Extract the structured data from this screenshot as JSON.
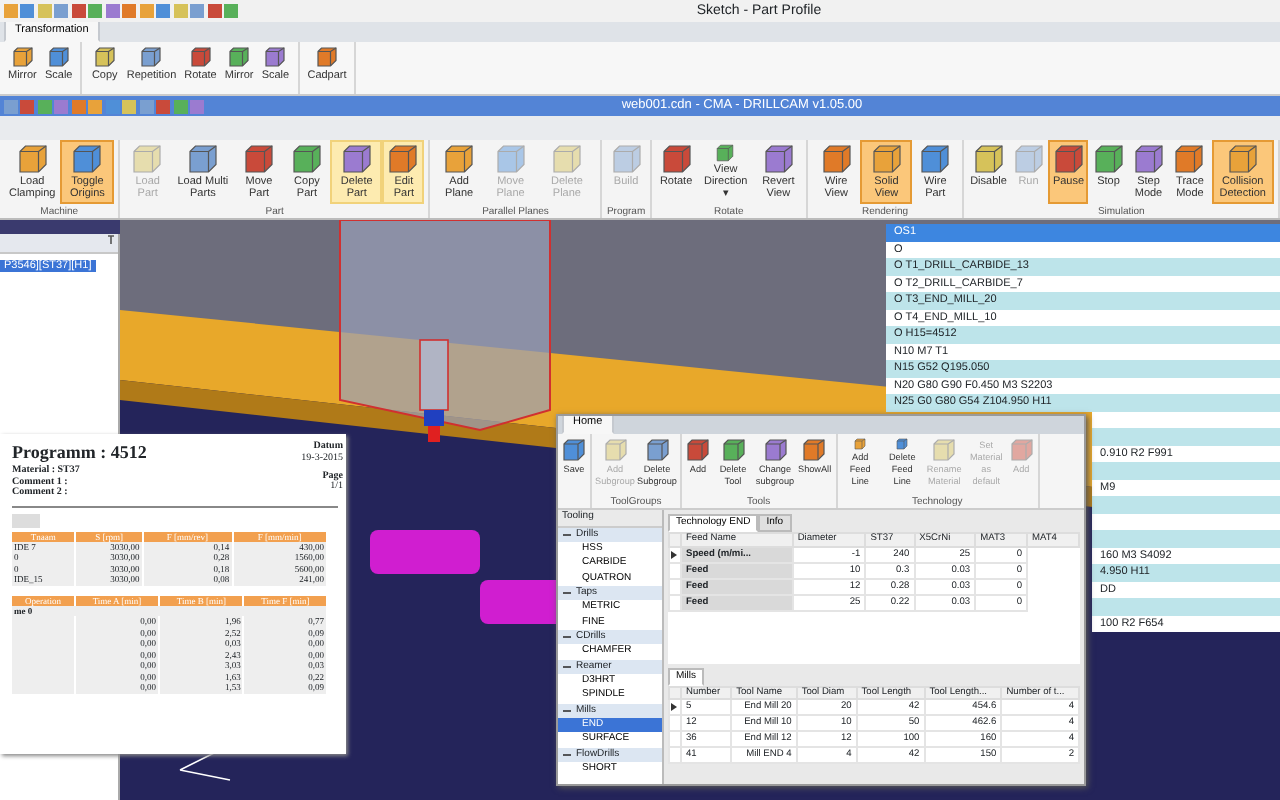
{
  "back_window": {
    "title": "Sketch - Part Profile",
    "tabs": [
      {
        "label": "Transformation",
        "selected": true
      }
    ],
    "ribbon": [
      {
        "buttons": [
          {
            "label": "Mirror",
            "disabled": false
          },
          {
            "label": "Scale",
            "disabled": false
          }
        ]
      },
      {
        "buttons": [
          {
            "label": "Copy",
            "disabled": false
          },
          {
            "label": "Repetition",
            "disabled": false
          },
          {
            "label": "Rotate",
            "disabled": false
          },
          {
            "label": "Mirror",
            "disabled": false
          },
          {
            "label": "Scale",
            "disabled": false
          }
        ]
      },
      {
        "buttons": [
          {
            "label": "Cadpart",
            "disabled": false
          }
        ]
      }
    ]
  },
  "main_window": {
    "title": "web001.cdn - CMA - DRILLCAM v1.05.00",
    "ribbon": [
      {
        "label": "Machine",
        "buttons": [
          {
            "label": "Load Clamping",
            "selected": false,
            "hover": false,
            "disabled": false
          },
          {
            "label": "Toggle Origins",
            "selected": true,
            "hover": false,
            "disabled": false
          }
        ]
      },
      {
        "label": "Part",
        "buttons": [
          {
            "label": "Load Part",
            "selected": false,
            "hover": false,
            "disabled": true
          },
          {
            "label": "Load Multi Parts",
            "selected": false,
            "hover": false,
            "disabled": false
          },
          {
            "label": "Move Part",
            "selected": false,
            "hover": false,
            "disabled": false
          },
          {
            "label": "Copy Part",
            "selected": false,
            "hover": false,
            "disabled": false
          },
          {
            "label": "Delete Part",
            "selected": false,
            "hover": true,
            "disabled": false
          },
          {
            "label": "Edit Part",
            "selected": false,
            "hover": true,
            "disabled": false
          }
        ]
      },
      {
        "label": "Parallel Planes",
        "buttons": [
          {
            "label": "Add Plane",
            "selected": false,
            "hover": false,
            "disabled": false
          },
          {
            "label": "Move Plane",
            "selected": false,
            "hover": false,
            "disabled": true
          },
          {
            "label": "Delete Plane",
            "selected": false,
            "hover": false,
            "disabled": true
          }
        ]
      },
      {
        "label": "Program",
        "buttons": [
          {
            "label": "Build",
            "selected": false,
            "hover": false,
            "disabled": true
          }
        ]
      },
      {
        "label": "Rotate",
        "buttons": [
          {
            "label": "Rotate",
            "selected": false,
            "hover": false,
            "disabled": false
          },
          {
            "label": "View Direction ▾",
            "selected": false,
            "hover": false,
            "disabled": false
          },
          {
            "label": "Revert View",
            "selected": false,
            "hover": false,
            "disabled": false
          }
        ]
      },
      {
        "label": "Rendering",
        "buttons": [
          {
            "label": "Wire View",
            "selected": false,
            "hover": false,
            "disabled": false
          },
          {
            "label": "Solid View",
            "selected": true,
            "hover": false,
            "disabled": false
          },
          {
            "label": "Wire Part",
            "selected": false,
            "hover": false,
            "disabled": false
          }
        ]
      },
      {
        "label": "Simulation",
        "buttons": [
          {
            "label": "Disable",
            "selected": false,
            "hover": false,
            "disabled": false
          },
          {
            "label": "Run",
            "selected": false,
            "hover": false,
            "disabled": true
          },
          {
            "label": "Pause",
            "selected": true,
            "hover": false,
            "disabled": false
          },
          {
            "label": "Stop",
            "selected": false,
            "hover": false,
            "disabled": false
          },
          {
            "label": "Step Mode",
            "selected": false,
            "hover": false,
            "disabled": false
          },
          {
            "label": "Trace Mode",
            "selected": false,
            "hover": false,
            "disabled": false
          },
          {
            "label": "Collision Detection",
            "selected": true,
            "hover": false,
            "disabled": false
          }
        ]
      }
    ]
  },
  "part_panel": {
    "items": [
      {
        "label": "P3546][ST37][H1]",
        "selected": true
      }
    ]
  },
  "nc_program": {
    "rows": [
      {
        "kind": "full",
        "text": "OS1",
        "selected": true
      },
      {
        "kind": "full",
        "text": "O",
        "selected": false
      },
      {
        "kind": "full",
        "text": "O T1_DRILL_CARBIDE_13",
        "selected": false
      },
      {
        "kind": "full",
        "text": "O T2_DRILL_CARBIDE_7",
        "selected": false
      },
      {
        "kind": "full",
        "text": "O T3_END_MILL_20",
        "selected": false
      },
      {
        "kind": "full",
        "text": "O T4_END_MILL_10",
        "selected": false
      },
      {
        "kind": "full",
        "text": "O H15=4512",
        "selected": false
      },
      {
        "kind": "full",
        "text": "N10 M7 T1",
        "selected": false
      },
      {
        "kind": "full",
        "text": "N15 G52 Q195.050",
        "selected": false
      },
      {
        "kind": "full",
        "text": "N20 G80 G90 F0.450 M3 S2203",
        "selected": false
      },
      {
        "kind": "full",
        "text": "N25 G0 G80 G54 Z104.950 H11",
        "selected": false
      },
      {
        "kind": "clipped",
        "selected": false
      },
      {
        "kind": "clipped",
        "selected": false
      },
      {
        "kind": "clipped",
        "text": "0.910 R2 F991",
        "selected": false
      },
      {
        "kind": "clipped",
        "selected": false
      },
      {
        "kind": "clipped",
        "text": "M9",
        "selected": false
      },
      {
        "kind": "clipped",
        "selected": false
      },
      {
        "kind": "clipped",
        "selected": false
      },
      {
        "kind": "clipped",
        "selected": false
      },
      {
        "kind": "clipped",
        "text": "160 M3 S4092",
        "selected": false
      },
      {
        "kind": "clipped",
        "text": "4.950 H11",
        "selected": false
      },
      {
        "kind": "clipped",
        "text": "DD",
        "selected": false
      },
      {
        "kind": "clipped",
        "selected": false
      },
      {
        "kind": "clipped",
        "text": "100 R2 F654",
        "selected": false
      }
    ]
  },
  "report": {
    "title": "Programm : 4512",
    "date_label": "Datum",
    "date": "19-3-2015",
    "material": "Material : ST37",
    "comment_1": "Comment 1 :",
    "comment_2": "Comment 2 :",
    "page_label": "Page",
    "page": "1/1",
    "tools_table": {
      "columns": [
        "Tnaam",
        "S [rpm]",
        "F [mm/rev]",
        "F [mm/min]"
      ],
      "rows": [
        [
          "IDE 7",
          "3030,00",
          "0,14",
          "430,00"
        ],
        [
          "0",
          "3030,00",
          "0,28",
          "1560,00"
        ],
        [
          "0",
          "3030,00",
          "0,18",
          "5600,00"
        ],
        [
          "IDE_15",
          "3030,00",
          "0,08",
          "241,00"
        ]
      ]
    },
    "times_table": {
      "columns": [
        "Operation",
        "Time A [min]",
        "Time B [min]",
        "Time F [min]"
      ],
      "rows": [
        {
          "kind": "group",
          "text": "me 0"
        },
        {
          "kind": "data",
          "cells": [
            "0,00",
            "1,96",
            "0,77"
          ]
        },
        {
          "kind": "data",
          "cells": [
            "0,00",
            "2,52",
            "0,09"
          ]
        },
        {
          "kind": "data",
          "cells": [
            "0,00",
            "0,03",
            "0,00"
          ]
        },
        {
          "kind": "data",
          "cells": [
            "0,00",
            "2,43",
            "0,00"
          ]
        },
        {
          "kind": "data",
          "cells": [
            "0,00",
            "3,03",
            "0,03"
          ]
        },
        {
          "kind": "data",
          "cells": [
            "0,00",
            "1,63",
            "0,22"
          ]
        },
        {
          "kind": "data",
          "cells": [
            "0,00",
            "1,53",
            "0,09"
          ]
        }
      ]
    }
  },
  "tool_window": {
    "tabs": [
      {
        "label": "Home",
        "selected": true
      }
    ],
    "ribbon": [
      {
        "buttons": [
          {
            "label": "Save",
            "disabled": false
          }
        ]
      },
      {
        "label": "ToolGroups",
        "buttons": [
          {
            "label": "Add Subgroup",
            "disabled": true
          },
          {
            "label": "Delete Subgroup",
            "disabled": false
          }
        ]
      },
      {
        "label": "Tools",
        "buttons": [
          {
            "label": "Add",
            "disabled": false
          },
          {
            "label": "Delete Tool",
            "disabled": false
          },
          {
            "label": "Change subgroup",
            "disabled": false
          },
          {
            "label": "ShowAll",
            "disabled": false
          }
        ]
      },
      {
        "label": "Technology",
        "buttons": [
          {
            "label": "Add Feed Line",
            "disabled": false
          },
          {
            "label": "Delete Feed Line",
            "disabled": false
          },
          {
            "label": "Rename Material",
            "disabled": true
          },
          {
            "label": "Set Material as default",
            "disabled": true
          },
          {
            "label": "Add",
            "disabled": true
          }
        ]
      }
    ],
    "tree": {
      "title": "Tooling",
      "items": [
        {
          "label": "Drills",
          "expanded": true,
          "children": [
            {
              "label": "HSS",
              "selected": false
            },
            {
              "label": "CARBIDE",
              "selected": false
            },
            {
              "label": "QUATRON",
              "selected": false
            }
          ]
        },
        {
          "label": "Taps",
          "expanded": true,
          "children": [
            {
              "label": "METRIC",
              "selected": false
            },
            {
              "label": "FINE",
              "selected": false
            }
          ]
        },
        {
          "label": "CDrills",
          "expanded": true,
          "children": [
            {
              "label": "CHAMFER",
              "selected": false
            }
          ]
        },
        {
          "label": "Reamer",
          "expanded": true,
          "children": [
            {
              "label": "D3HRT",
              "selected": false
            },
            {
              "label": "SPINDLE",
              "selected": false
            }
          ]
        },
        {
          "label": "Mills",
          "expanded": true,
          "children": [
            {
              "label": "END",
              "selected": true
            },
            {
              "label": "SURFACE",
              "selected": false
            }
          ]
        },
        {
          "label": "FlowDrills",
          "expanded": true,
          "children": [
            {
              "label": "SHORT",
              "selected": false
            }
          ]
        }
      ]
    },
    "technology_tabs": [
      {
        "label": "Technology END",
        "selected": true
      },
      {
        "label": "Info",
        "selected": false
      }
    ],
    "technology_table": {
      "columns": [
        "Feed Name",
        "Diameter",
        "ST37",
        "X5CrNi",
        "MAT3",
        "MAT4"
      ],
      "rows": [
        {
          "selected": true,
          "cells": [
            "Speed (m/mi...",
            "-1",
            "240",
            "25",
            "0"
          ]
        },
        {
          "selected": false,
          "cells": [
            "Feed",
            "10",
            "0.3",
            "0.03",
            "0"
          ]
        },
        {
          "selected": false,
          "cells": [
            "Feed",
            "12",
            "0.28",
            "0.03",
            "0"
          ]
        },
        {
          "selected": false,
          "cells": [
            "Feed",
            "25",
            "0.22",
            "0.03",
            "0"
          ]
        }
      ]
    },
    "tools_tabs": [
      {
        "label": "Mills",
        "selected": true
      }
    ],
    "tools_table": {
      "columns": [
        "Number",
        "Tool Name",
        "Tool Diam",
        "Tool Length",
        "Tool Length...",
        "Number of t..."
      ],
      "rows": [
        {
          "selected": true,
          "cells": [
            "5",
            "End Mill 20",
            "20",
            "42",
            "454.6",
            "4"
          ]
        },
        {
          "selected": false,
          "cells": [
            "12",
            "End Mill 10",
            "10",
            "50",
            "462.6",
            "4"
          ]
        },
        {
          "selected": false,
          "cells": [
            "36",
            "End Mill 12",
            "12",
            "100",
            "160",
            "4"
          ]
        },
        {
          "selected": false,
          "cells": [
            "41",
            "Mill END 4",
            "4",
            "42",
            "150",
            "2"
          ]
        }
      ]
    }
  }
}
